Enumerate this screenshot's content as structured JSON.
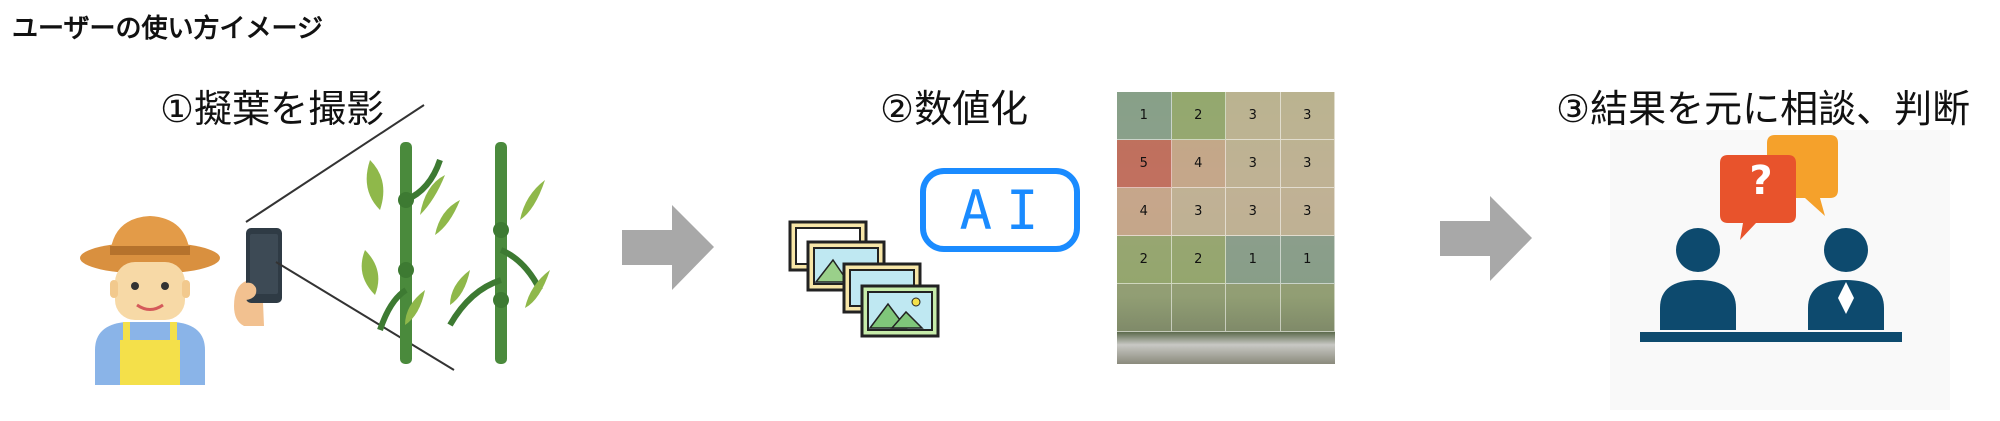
{
  "title": "ユーザーの使い方イメージ",
  "steps": [
    {
      "label": "①擬葉を撮影"
    },
    {
      "label": "②数値化"
    },
    {
      "label": "③結果を元に相談、判断"
    }
  ],
  "ai_label": "AI",
  "question_mark": "?",
  "grid": {
    "rows": [
      [
        "1",
        "2",
        "3",
        "3"
      ],
      [
        "5",
        "4",
        "3",
        "3"
      ],
      [
        "4",
        "3",
        "3",
        "3"
      ],
      [
        "2",
        "2",
        "1",
        "1"
      ]
    ],
    "colors": {
      "5": "#c9574f",
      "4": "#cfa58c",
      "3": "#c6b59a",
      "2": "#8ea56a",
      "1": "#7d9a8f"
    }
  },
  "icons": [
    "farmer-icon",
    "smartphone-icon",
    "asparagus-plant-icon",
    "arrow-right-icon",
    "images-stack-icon",
    "ai-badge-icon",
    "speech-bubble-icon",
    "consultation-people-icon"
  ]
}
